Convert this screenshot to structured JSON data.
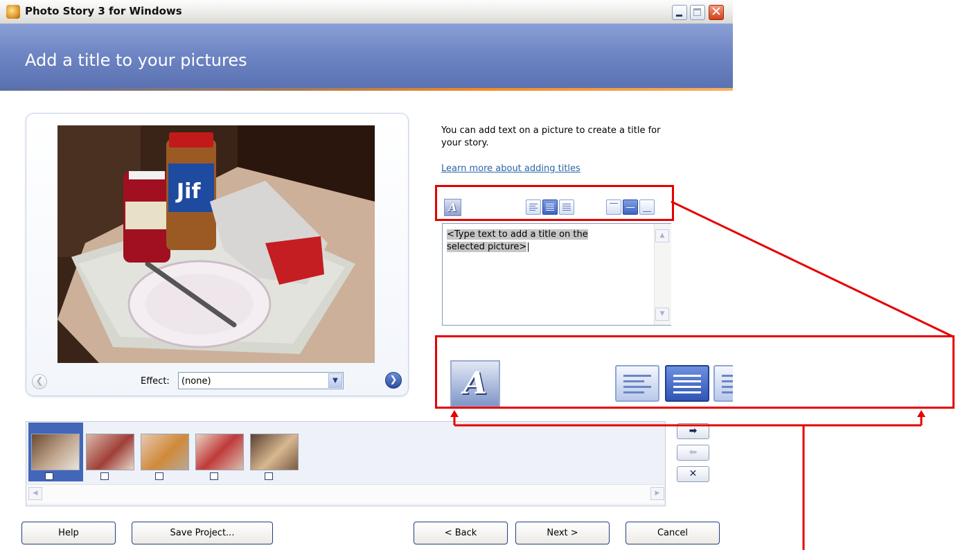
{
  "window": {
    "title": "Photo Story 3 for Windows",
    "controls": {
      "minimize": "",
      "maximize": "",
      "close": "✕"
    }
  },
  "header": {
    "title": "Add a title to your pictures"
  },
  "preview": {
    "effect_label": "Effect:",
    "effect_value": "(none)",
    "prev_arrow": "❮",
    "next_arrow": "❯"
  },
  "info": {
    "text": "You can add text on a picture to create a title for your story.",
    "link": "Learn more about adding titles"
  },
  "toolbar": {
    "font_icon": "A",
    "align_h": [
      "align-left",
      "align-center",
      "align-right"
    ],
    "align_h_selected": "align-center",
    "align_v": [
      "align-top",
      "align-middle",
      "align-bottom"
    ],
    "align_v_selected": "align-middle"
  },
  "title_input": {
    "value_line1": "<Type text to add a title on the",
    "value_line2": "selected picture>"
  },
  "filmstrip": {
    "thumbnails": 5,
    "selected_index": 0,
    "nav": {
      "move_right": "➡",
      "move_left": "⬅",
      "remove": "✕"
    }
  },
  "buttons": {
    "help": "Help",
    "save_project": "Save Project...",
    "back": "< Back",
    "next": "Next >",
    "cancel": "Cancel"
  },
  "colors": {
    "header": "#6f86c4",
    "annotation": "#e60000",
    "link": "#2a65a8"
  }
}
